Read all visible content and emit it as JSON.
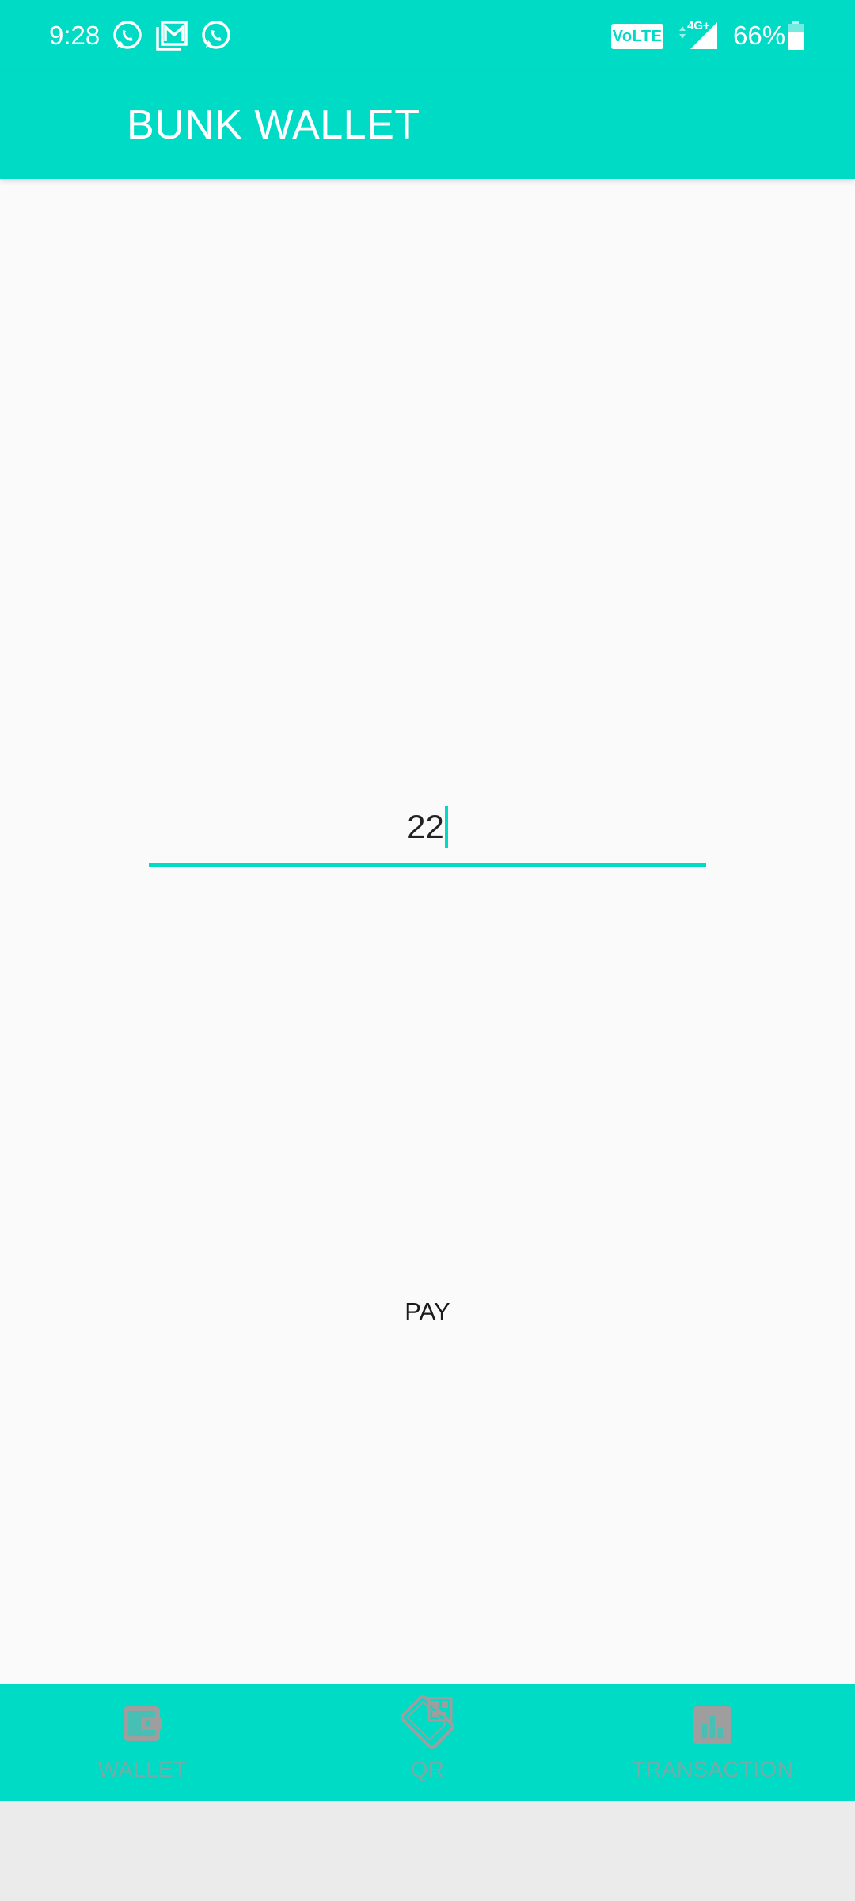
{
  "status_bar": {
    "time": "9:28",
    "notification_icons": [
      "whatsapp-icon",
      "gallery-icon",
      "whatsapp-icon"
    ],
    "network_badge": "VoLTE",
    "network_type": "4G+",
    "battery_percent": "66%",
    "battery_level": 0.66
  },
  "app_bar": {
    "title": "BUNK WALLET"
  },
  "payment": {
    "amount_value": "22",
    "pay_label": "PAY"
  },
  "bottom_nav": {
    "items": [
      {
        "label": "WALLET",
        "icon": "wallet-icon"
      },
      {
        "label": "QR",
        "icon": "qr-code-icon"
      },
      {
        "label": "TRANSACTION",
        "icon": "bar-chart-icon"
      }
    ]
  },
  "colors": {
    "accent": "#00dbc6",
    "background": "#fafafa",
    "nav_label": "#9d9d9d",
    "nav_icon": "#9e9e9e"
  }
}
